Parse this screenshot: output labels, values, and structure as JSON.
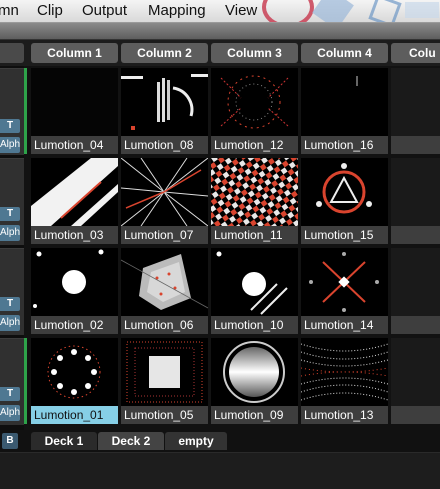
{
  "menu": {
    "items": [
      "mn",
      "Clip",
      "Output",
      "Mapping",
      "View"
    ]
  },
  "columns": [
    "Column 1",
    "Column 2",
    "Column 3",
    "Column 4",
    "Colu"
  ],
  "layers": {
    "toggle_label": "T",
    "blend_label": "Alph"
  },
  "clips": [
    [
      "Lumotion_04",
      "Lumotion_08",
      "Lumotion_12",
      "Lumotion_16"
    ],
    [
      "Lumotion_03",
      "Lumotion_07",
      "Lumotion_11",
      "Lumotion_15"
    ],
    [
      "Lumotion_02",
      "Lumotion_06",
      "Lumotion_10",
      "Lumotion_14"
    ],
    [
      "Lumotion_01",
      "Lumotion_05",
      "Lumotion_09",
      "Lumotion_13"
    ]
  ],
  "selected_clip": "Lumotion_01",
  "decks": {
    "b_label": "B",
    "tabs": [
      "Deck 1",
      "Deck 2",
      "empty"
    ]
  },
  "colors": {
    "accent_selected": "#86cfe6",
    "layer_button": "#4f7892",
    "active_line": "#2ea34a",
    "visual_red": "#d9442e"
  }
}
